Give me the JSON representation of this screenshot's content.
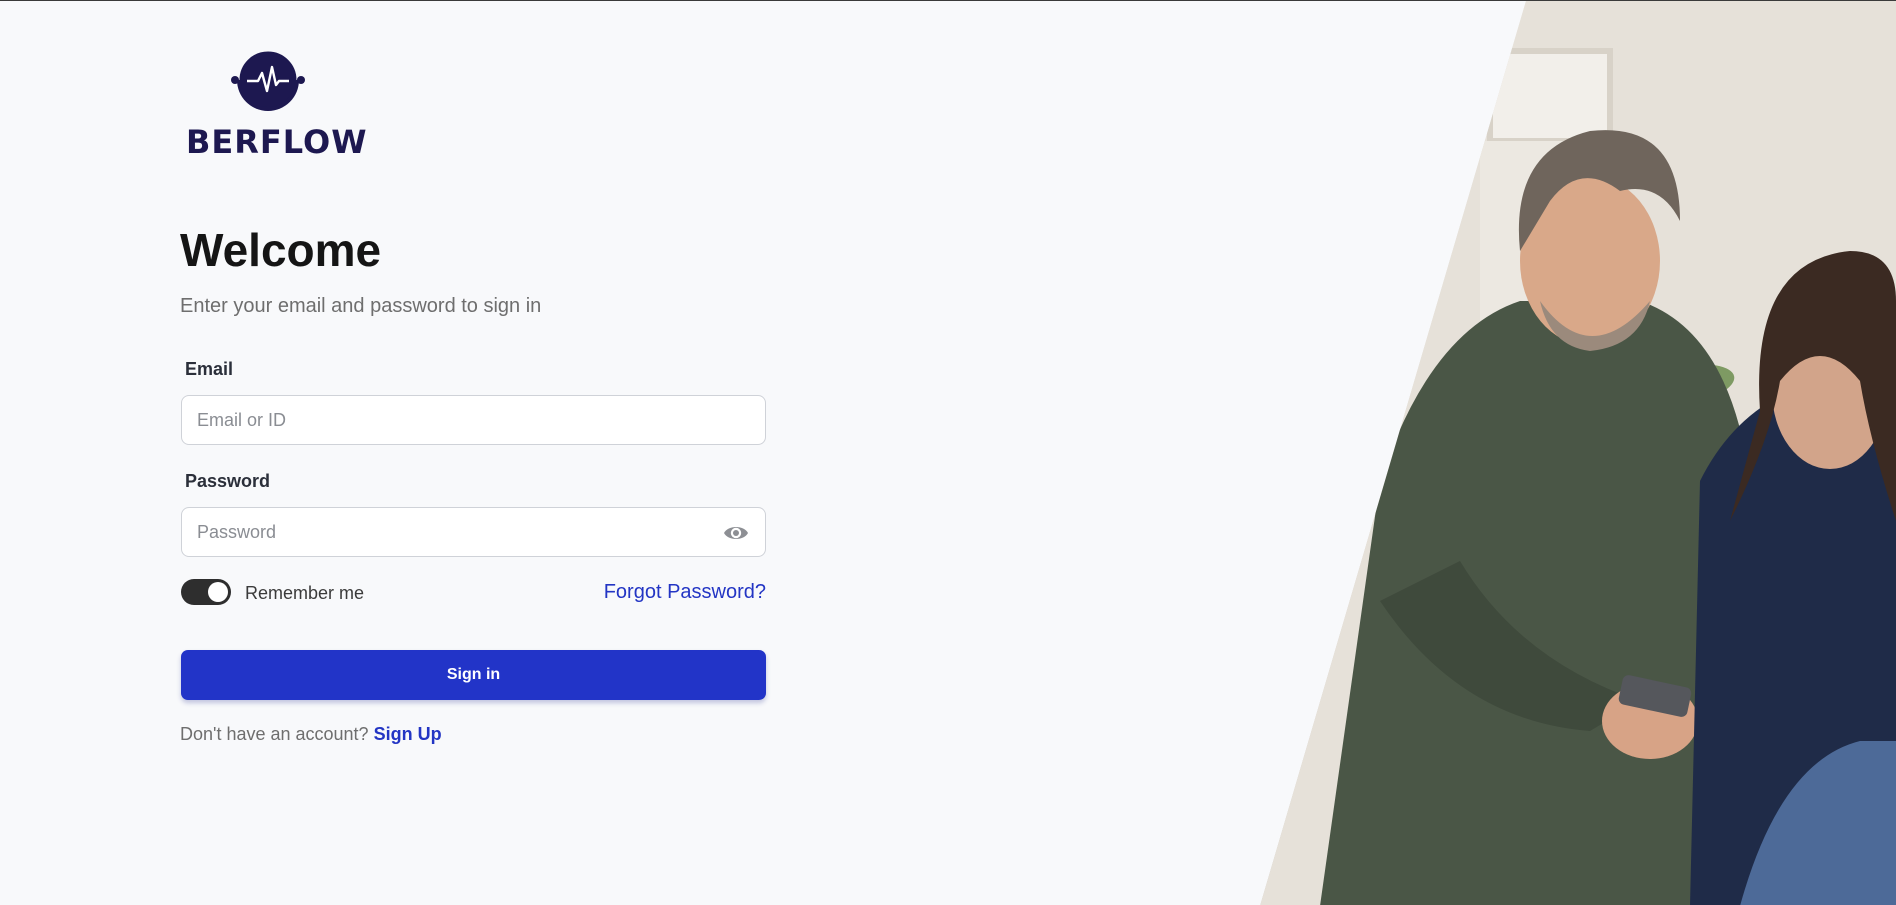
{
  "brand": {
    "name": "BERFLOW",
    "logo_icon": "pulse-circle-icon",
    "color": "#1d1850"
  },
  "form": {
    "title": "Welcome",
    "subtitle": "Enter your email and password to sign in",
    "email": {
      "label": "Email",
      "value": "",
      "placeholder": "Email or ID"
    },
    "password": {
      "label": "Password",
      "value": "",
      "placeholder": "Password",
      "toggle_icon": "eye-icon"
    },
    "remember": {
      "label": "Remember me",
      "enabled": true
    },
    "forgot_label": "Forgot Password?",
    "submit_label": "Sign in",
    "signup_prompt": "Don't have an account?",
    "signup_label": "Sign Up"
  },
  "colors": {
    "accent": "#2234c8",
    "link": "#2335c4",
    "background": "#f8f9fb",
    "toggle_on": "#2e2e2e"
  },
  "hero_image": {
    "icon": "couple-using-phone-photo"
  }
}
